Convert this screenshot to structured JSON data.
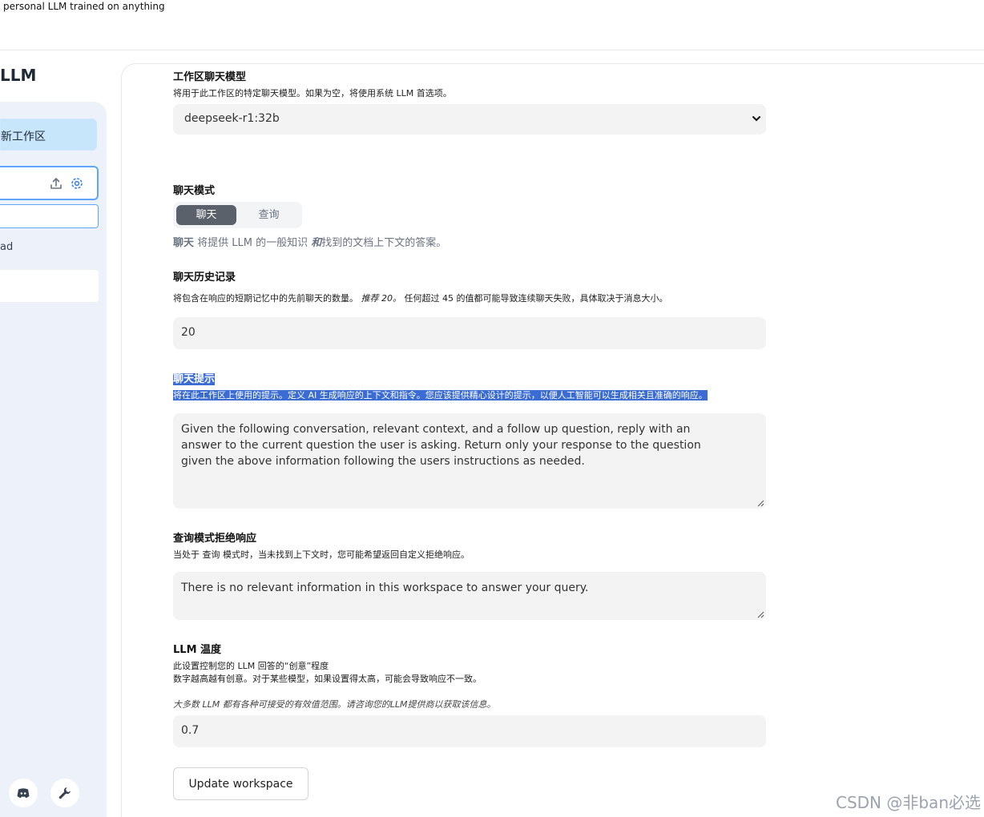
{
  "header": {
    "tagline": "personal LLM trained on anything"
  },
  "brand": {
    "title": "LLM"
  },
  "sidebar": {
    "active_workspace_label": "新工作区",
    "thread_label": "ad"
  },
  "settings": {
    "chat_model": {
      "label": "工作区聊天模型",
      "description": "将用于此工作区的特定聊天模型。如果为空，将使用系统 LLM 首选项。",
      "value": "deepseek-r1:32b"
    },
    "chat_mode": {
      "label": "聊天模式",
      "options": [
        "聊天",
        "查询"
      ],
      "selected": "聊天",
      "desc_strong": "聊天",
      "desc_mid": " 将提供 LLM 的一般知识 ",
      "desc_em": "和",
      "desc_end": "找到的文档上下文的答案。"
    },
    "history": {
      "label": "聊天历史记录",
      "desc_start": "将包含在响应的短期记忆中的先前聊天的数量。 ",
      "desc_em": "推荐 20。",
      "desc_end": " 任何超过 45 的值都可能导致连续聊天失败，具体取决于消息大小。",
      "value": "20"
    },
    "prompt": {
      "label": "聊天提示",
      "description": "将在此工作区上使用的提示。定义 AI 生成响应的上下文和指令。您应该提供精心设计的提示，以便人工智能可以生成相关且准确的响应。",
      "value": "Given the following conversation, relevant context, and a follow up question, reply with an answer to the current question the user is asking. Return only your response to the question given the above information following the users instructions as needed."
    },
    "refusal": {
      "label": "查询模式拒绝响应",
      "desc_start": "当处于 ",
      "desc_code": "查询",
      "desc_end": " 模式时，当未找到上下文时，您可能希望返回自定义拒绝响应。",
      "value": "There is no relevant information in this workspace to answer your query."
    },
    "temperature": {
      "label": "LLM 温度",
      "desc_line1": "此设置控制您的 LLM 回答的“创意”程度",
      "desc_line2": "数字越高越有创意。对于某些模型，如果设置得太高，可能会导致响应不一致。",
      "desc_note": "大多数 LLM 都有各种可接受的有效值范围。请咨询您的LLM提供商以获取该信息。",
      "value": "0.7"
    },
    "update_label": "Update workspace"
  },
  "watermark": "CSDN @非ban必选",
  "icons": {
    "upload": "upload-icon",
    "settings": "gear-icon",
    "discord": "discord-icon",
    "wrench": "wrench-icon",
    "dropdown": "chevron-down-icon"
  },
  "colors": {
    "accent": "#60a5fa",
    "active_ws": "#c7e6fb",
    "highlight": "#3b6cd4",
    "toggle_active": "#5b616b"
  }
}
